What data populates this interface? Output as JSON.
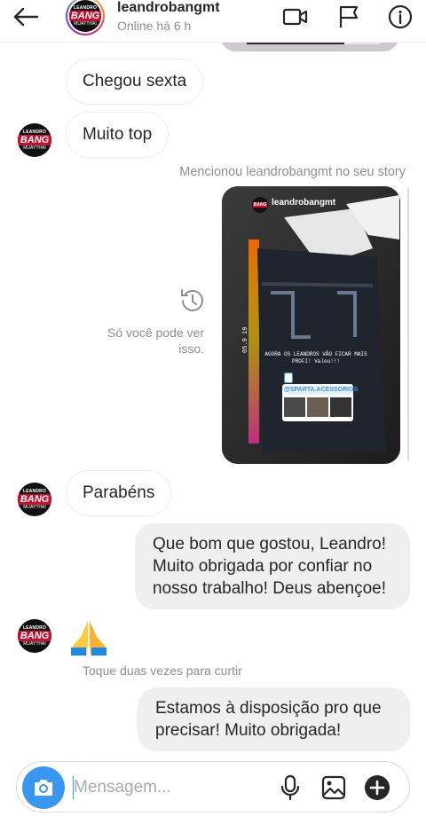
{
  "header": {
    "username": "leandrobangmt",
    "status": "Online há 6 h"
  },
  "logo": {
    "line1": "LEANDRO",
    "line2": "BANG",
    "line3": "MUAYTHAI"
  },
  "messages": [
    {
      "from": "them",
      "text": "Chegou sexta"
    },
    {
      "from": "them",
      "text": "Muito top"
    },
    {
      "from": "them",
      "text": "Parabéns"
    },
    {
      "from": "me",
      "text": "Que bom que gostou, Leandro! Muito obrigada por confiar no nosso trabalho! Deus abençoe!"
    },
    {
      "from": "me",
      "text": "Estamos à disposição pro que precisar! Muito obrigada!"
    }
  ],
  "story_mention": {
    "caption": "Mencionou leandrobangmt no seu story",
    "story_username": "leandrobangmt",
    "story_text": "AGORA OS LEANDROS VÃO FICAR MAIS PROFI! Valeu!!!",
    "sticker_mention": "@SPARTA.ACESSORIOS",
    "private_note": "Só você pode ver isso."
  },
  "like_hint": "Toque duas vezes para curtir",
  "composer": {
    "placeholder": "Mensagem..."
  },
  "colors": {
    "accent": "#3897f0",
    "bubble_out": "#efefef",
    "muted_text": "#8e8e8e"
  }
}
